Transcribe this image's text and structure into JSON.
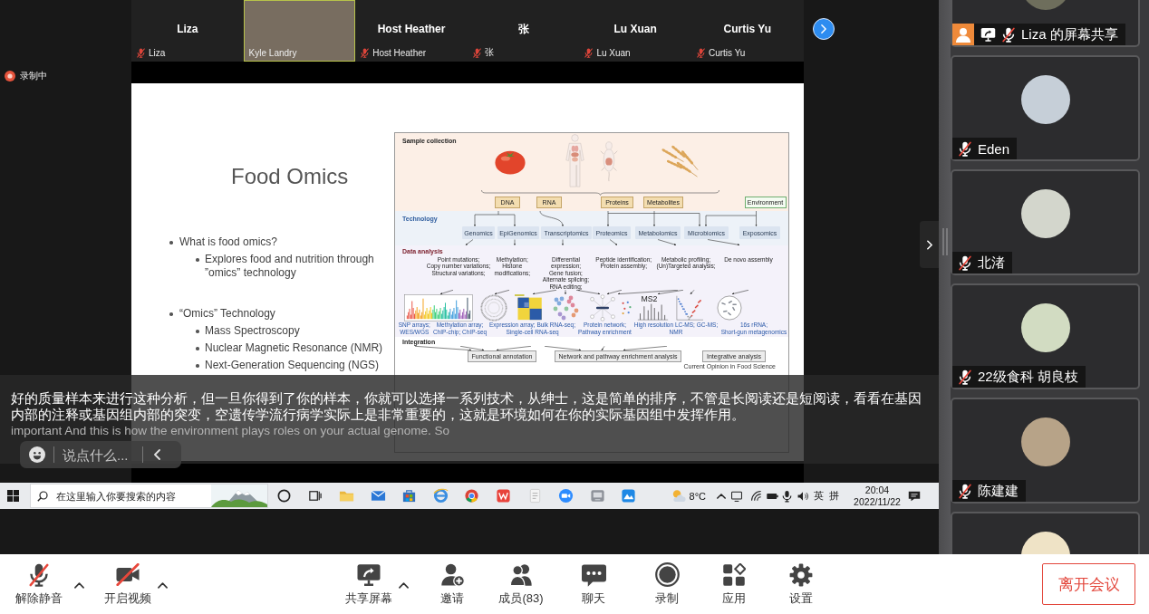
{
  "recording": {
    "label": "录制中"
  },
  "strip": {
    "tiles": [
      {
        "kind": "name",
        "name": "Liza",
        "label": "Liza",
        "muted": true,
        "speaking": false
      },
      {
        "kind": "video",
        "label": "Kyle Landry",
        "muted": false,
        "speaking": true
      },
      {
        "kind": "name",
        "name": "Host Heather",
        "label": "Host Heather",
        "muted": true,
        "speaking": false
      },
      {
        "kind": "name",
        "name": "张",
        "label": "张",
        "muted": true,
        "speaking": false
      },
      {
        "kind": "name",
        "name": "Lu Xuan",
        "label": "Lu Xuan",
        "muted": true,
        "speaking": false
      },
      {
        "kind": "name",
        "name": "Curtis Yu",
        "label": "Curtis Yu",
        "muted": true,
        "speaking": false
      }
    ]
  },
  "slide": {
    "title": "Food Omics",
    "bullets": [
      {
        "text": "What is food omics?",
        "children": [
          {
            "text": "Explores food and nutrition through\n”omics” technology"
          }
        ]
      },
      {
        "text": "“Omics” Technology",
        "children": [
          {
            "text": "Mass Spectroscopy"
          },
          {
            "text": "Nuclear Magnetic Resonance (NMR)"
          },
          {
            "text": "Next-Generation Sequencing (NGS)"
          }
        ]
      }
    ],
    "figure": {
      "collection_label": "Sample collection",
      "sources": [
        {
          "label": "DNA",
          "kind": "molecule"
        },
        {
          "label": "RNA",
          "kind": "molecule"
        },
        {
          "label": "Proteins",
          "kind": "molecule"
        },
        {
          "label": "Metabolites",
          "kind": "molecule"
        },
        {
          "label": "Environment",
          "kind": "environment"
        }
      ],
      "technology_label": "Technology",
      "technologies": [
        "Genomics",
        "EpiGenomics",
        "Transcriptomics",
        "Proteomics",
        "Metabolomics",
        "Microbiomics",
        "Exposomics"
      ],
      "analysis_label": "Data analysis",
      "analyses": [
        "Point mutations;\nCopy number variations;\nStructural variations;",
        "Methylation;\nHistone\nmodifications;",
        "Differential\nexpression;\nGene fusion;\nAlternate splicing;\nRNA editing;",
        "Peptide identification;\nProtein assembly;",
        "Metabolic profiling;\n(Un)Targeted analysis;",
        "De novo assembly"
      ],
      "spectrum_label": "MS2",
      "methods": [
        "SNP arrays;\nWES/WGS",
        "Methylation array;\nChIP-chip; ChIP-seq",
        "Expression array; Bulk RNA-seq;\nSingle-cell RNA-seq",
        "Protein network;\nPathway enrichment",
        "High resolution LC-MS; GC-MS;\nNMR",
        "16s rRNA;\nShort-gun metagenomics"
      ],
      "integration_label": "Integration",
      "integrations": [
        "Functional annotation",
        "Network and pathway enrichment analysis",
        "Integrative analysis"
      ],
      "credit": "Current Opinion in Food Science"
    }
  },
  "subtitles": {
    "translation": "好的质量样本来进行这种分析，但一旦你得到了你的样本，你就可以选择一系列技术，从绅士，这是简单的排序，不管是长阅读还是短阅读，看看在基因内部的注释或基因组内部的突变，空遗传学流行病学实际上是非常重要的，这就是环境如何在你的实际基因组中发挥作用。",
    "transcript": "important And this is how the environment plays roles on your actual genome. So"
  },
  "chat_input": {
    "placeholder": "说点什么..."
  },
  "taskbar": {
    "search_placeholder": "在这里输入你要搜索的内容",
    "temperature": "8°C",
    "input_modes": [
      "英",
      "拼"
    ],
    "time": "20:04",
    "date": "2022/11/22"
  },
  "side_panel": {
    "tiles": [
      {
        "kind": "share",
        "label": "Liza 的屏幕共享",
        "muted": true
      },
      {
        "kind": "avatar",
        "label": "Eden",
        "muted": true
      },
      {
        "kind": "avatar",
        "label": "北渚",
        "muted": true
      },
      {
        "kind": "avatar",
        "label": "22级食科 胡良枝",
        "muted": true
      },
      {
        "kind": "avatar",
        "label": "陈建建",
        "muted": true
      },
      {
        "kind": "avatar"
      }
    ]
  },
  "toolbar": {
    "items": [
      {
        "kind": "audio",
        "label": "解除静音",
        "off": true,
        "menu": true
      },
      {
        "kind": "video",
        "label": "开启视频",
        "off": true,
        "menu": true
      },
      {
        "kind": "share",
        "label": "共享屏幕",
        "menu": true
      },
      {
        "kind": "invite",
        "label": "邀请",
        "menu": false
      },
      {
        "kind": "participants",
        "label": "成员(83)",
        "menu": false
      },
      {
        "kind": "chat",
        "label": "聊天",
        "menu": false
      },
      {
        "kind": "record",
        "label": "录制",
        "menu": false
      },
      {
        "kind": "apps",
        "label": "应用",
        "menu": false
      },
      {
        "kind": "settings",
        "label": "设置",
        "menu": false
      }
    ],
    "leave": "离开会议"
  }
}
